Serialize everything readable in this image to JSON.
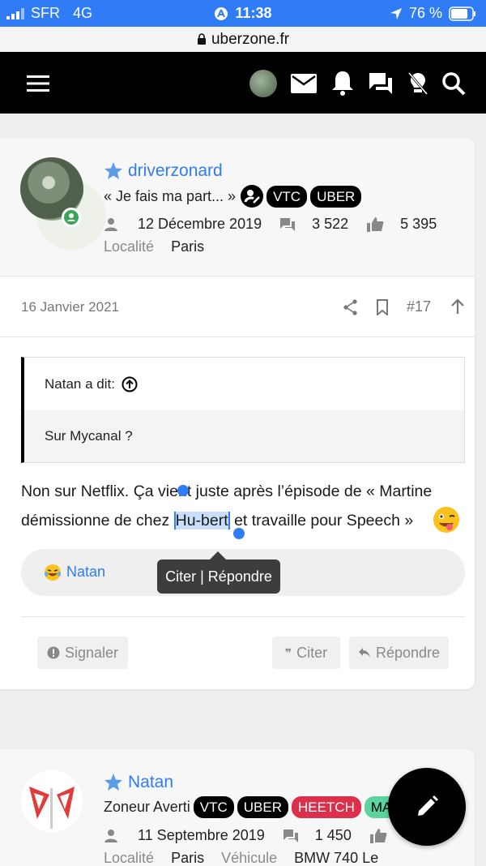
{
  "status_bar": {
    "carrier": "SFR",
    "network": "4G",
    "time": "11:38",
    "battery": "76 %"
  },
  "browser": {
    "url": "uberzone.fr"
  },
  "navbar": {
    "icons": [
      "menu-icon",
      "avatar",
      "mail-icon",
      "bell-icon",
      "chat-icon",
      "bulb-off-icon",
      "search-icon"
    ]
  },
  "post1": {
    "user": {
      "name": "driverzonard",
      "title": "« Je fais ma part... »",
      "badges": [
        "VTC",
        "UBER"
      ],
      "joined": "12 Décembre 2019",
      "messages": "3 522",
      "likes": "5 395",
      "location_label": "Localité",
      "location": "Paris"
    },
    "date": "16 Janvier 2021",
    "number": "#17",
    "quote": {
      "author": "Natan a dit:",
      "text": "Sur Mycanal ?"
    },
    "body_line1": "Non sur Netflix. Ça vient juste après l’épisode de « Martine",
    "body_line2_a": "démissionne de chez ",
    "body_selected": "Hu-bert",
    "body_line2_b": " et travaille pour Speech »",
    "reaction_user": "Natan",
    "tooltip": "Citer | Répondre",
    "actions": {
      "report": "Signaler",
      "quote": "Citer",
      "reply": "Répondre"
    }
  },
  "post2": {
    "user": {
      "name": "Natan",
      "title": "Zoneur Averti",
      "badges": [
        "VTC",
        "UBER",
        "HEETCH",
        "MA"
      ],
      "joined": "11 Septembre 2019",
      "messages": "1 450",
      "location_label": "Localité",
      "location": "Paris",
      "vehicle_label": "Véhicule",
      "vehicle": "BMW 740 Le"
    }
  },
  "colors": {
    "accent": "#2f7cf6",
    "selection": "#c9def8",
    "link": "#2f7cf6"
  }
}
